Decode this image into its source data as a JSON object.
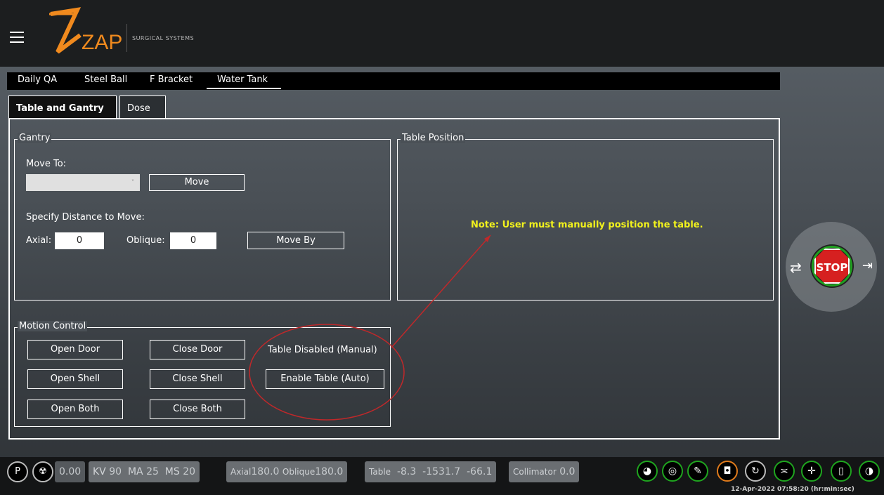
{
  "header": {
    "logo_text": "ZAP",
    "logo_subtitle": "SURGICAL SYSTEMS"
  },
  "nav": {
    "tabs": [
      "Daily QA",
      "Steel Ball",
      "F Bracket",
      "Water Tank"
    ],
    "active": "Water Tank"
  },
  "subtabs": {
    "table_and_gantry": "Table and Gantry",
    "dose": "Dose"
  },
  "gantry": {
    "group_label": "Gantry",
    "move_to_label": "Move To:",
    "select_value": "",
    "select_arrow": "˅",
    "move_button": "Move",
    "specify_label": "Specify Distance to Move:",
    "axial_label": "Axial:",
    "axial_value": "0",
    "oblique_label": "Oblique:",
    "oblique_value": "0",
    "move_by_button": "Move By"
  },
  "table_position": {
    "group_label": "Table Position",
    "note": "Note: User must manually position the table."
  },
  "motion": {
    "group_label": "Motion Control",
    "open_door": "Open Door",
    "close_door": "Close Door",
    "open_shell": "Open Shell",
    "close_shell": "Close Shell",
    "open_both": "Open Both",
    "close_both": "Close Both",
    "table_status": "Table Disabled (Manual)",
    "enable_table": "Enable Table (Auto)"
  },
  "stop": {
    "label": "STOP"
  },
  "status": {
    "p_label": "P",
    "dose_value": "0.00",
    "kv_label": "KV",
    "kv_value": "90",
    "ma_label": "MA",
    "ma_value": "25",
    "ms_label": "MS",
    "ms_value": "20",
    "axial_label": "Axial",
    "axial_value": "180.0",
    "oblique_label": "Oblique",
    "oblique_value": "180.0",
    "table_label": "Table",
    "table_x": "-8.3",
    "table_y": "-1531.7",
    "table_z": "-66.1",
    "collimator_label": "Collimator",
    "collimator_value": "0.0",
    "timestamp": "12-Apr-2022 07:58:20 (hr:min:sec)"
  },
  "colors": {
    "note": "#f2f21c",
    "stop": "#d62020",
    "status_ring": "#1fa51f",
    "annotation": "#c0282a"
  }
}
